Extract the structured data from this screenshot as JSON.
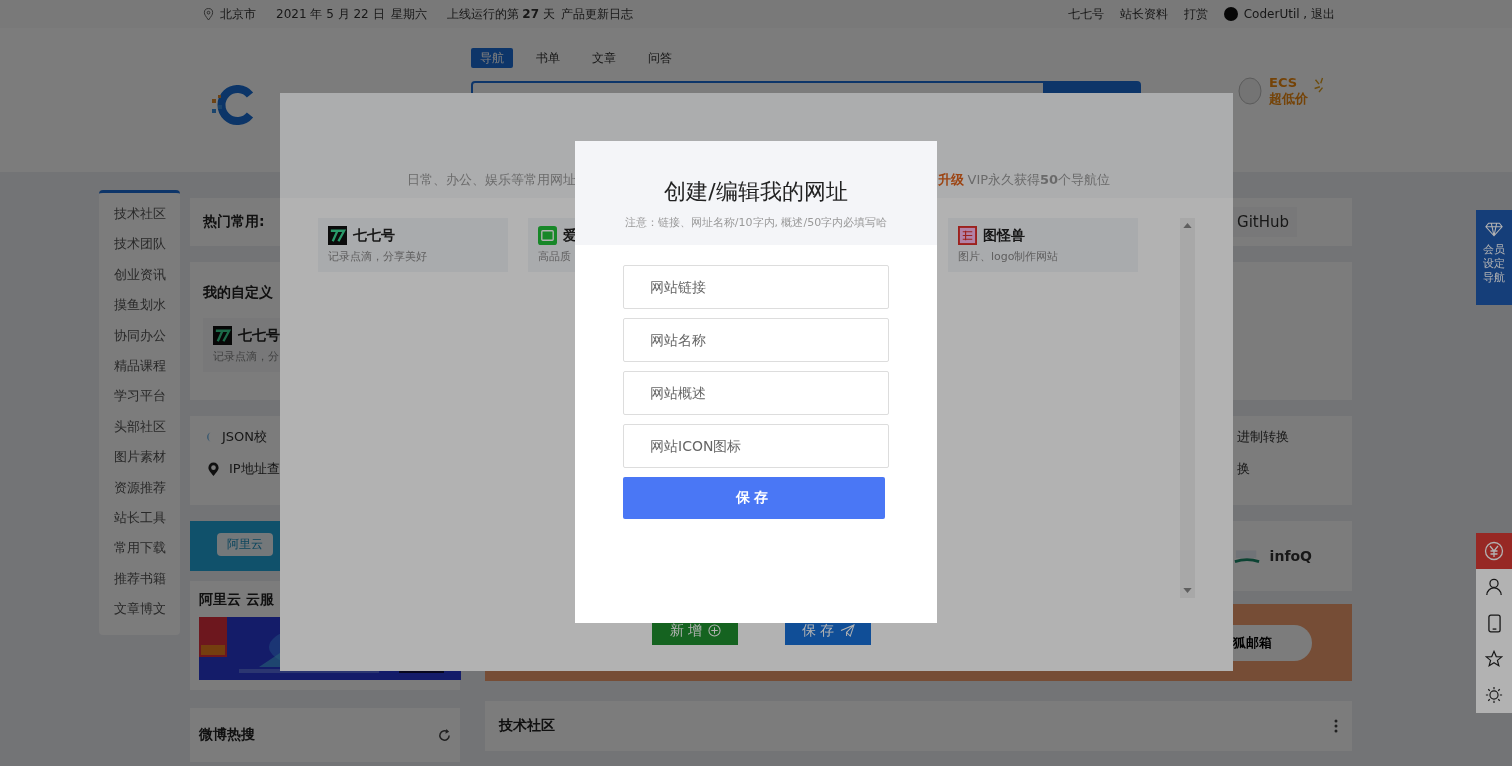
{
  "top_bar": {
    "location": "北京市",
    "date": "2021 年 5 月 22 日",
    "weekday": "星期六",
    "uptime": "上线运行的第 **27** 天",
    "changelog": "产品更新日志",
    "links": [
      "七七号",
      "站长资料",
      "打赏"
    ],
    "user": "CoderUtil , 退出"
  },
  "header": {
    "tabs": [
      {
        "label": "导航",
        "selected": true
      },
      {
        "label": "书单",
        "selected": false
      },
      {
        "label": "文章",
        "selected": false
      },
      {
        "label": "问答",
        "selected": false
      }
    ],
    "ad": [
      "ECS",
      "超低价"
    ]
  },
  "sidebar": {
    "items": [
      "技术社区",
      "技术团队",
      "创业资讯",
      "摸鱼划水",
      "协同办公",
      "精品课程",
      "学习平台",
      "头部社区",
      "图片素材",
      "资源推荐",
      "站长工具",
      "常用下载",
      "推荐书籍",
      "文章博文"
    ]
  },
  "hot": {
    "title": "热门常用:",
    "items": [
      "GitHub"
    ]
  },
  "custom": {
    "title": "我的自定义",
    "sites": [
      {
        "name": "七七号",
        "desc": "记录点滴，分"
      }
    ]
  },
  "tools": {
    "rows": [
      {
        "kind": "json",
        "label": "JSON校",
        "right": "进制转换"
      },
      {
        "kind": "ip",
        "label": "IP地址查",
        "right": "换"
      }
    ]
  },
  "cloud_tabs": [
    "阿里云"
  ],
  "infoq": "infoQ",
  "aliyun": {
    "title": "阿里云 云服"
  },
  "promo": {
    "button": "狐邮箱"
  },
  "weibo": {
    "title": "微博热搜"
  },
  "tech": {
    "title": "技术社区"
  },
  "member_float": "会员设定导航",
  "manager_modal": {
    "subtitle_left": "日常、办公、娱乐等常用网址",
    "upgrade": "升级",
    "subtitle_right": "VIP永久获得**50**个导航位",
    "sites": [
      {
        "name": "七七号",
        "desc": "记录点滴，分享美好",
        "kind": "qiqi"
      },
      {
        "name": "爱",
        "desc": "高品质",
        "kind": "tv"
      },
      {
        "name": "图怪兽",
        "desc": "图片、logo制作网站",
        "kind": "seal"
      }
    ],
    "buttons": [
      {
        "kind": "add",
        "label": "新增"
      },
      {
        "kind": "save",
        "label": "保存"
      }
    ]
  },
  "edit_modal": {
    "title": "创建/编辑我的网址",
    "note": "注意：链接、网址名称/10字内, 概述/50字内必填写哈",
    "fields": [
      {
        "placeholder": "网站链接"
      },
      {
        "placeholder": "网站名称"
      },
      {
        "placeholder": "网站概述"
      },
      {
        "placeholder": "网站ICON图标"
      }
    ],
    "button": "保存"
  }
}
